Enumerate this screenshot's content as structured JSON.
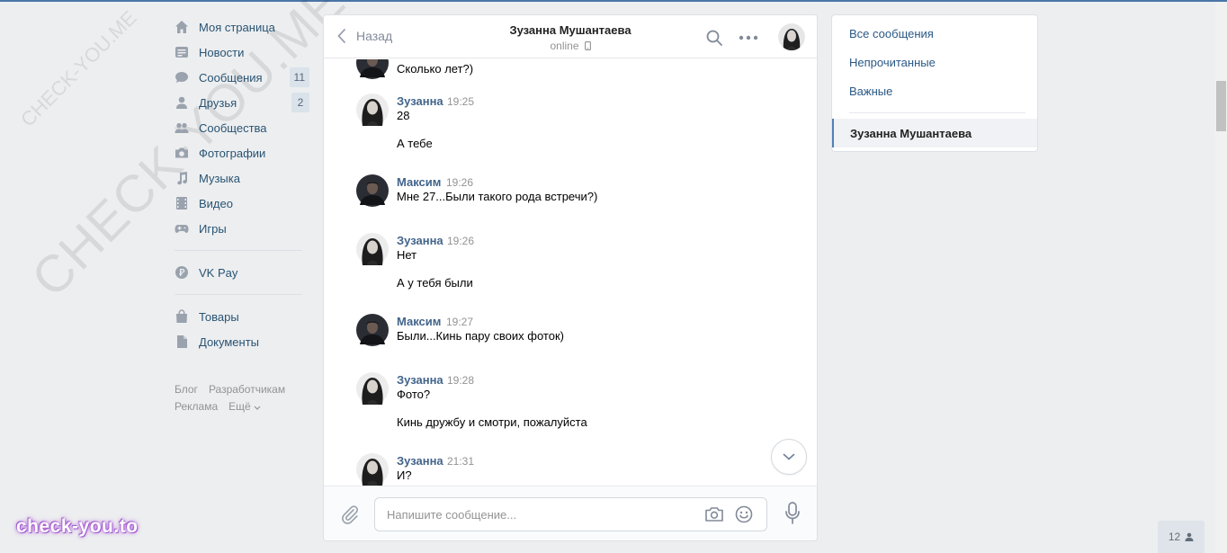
{
  "watermark": {
    "small": "CHECK-YOU.ME",
    "big": "CHECK-YOU.ME",
    "brand": "check-you.to"
  },
  "nav": {
    "items": [
      {
        "label": "Моя страница",
        "icon": "home-icon"
      },
      {
        "label": "Новости",
        "icon": "news-icon"
      },
      {
        "label": "Сообщения",
        "icon": "messages-icon",
        "count": "11"
      },
      {
        "label": "Друзья",
        "icon": "friends-icon",
        "count": "2"
      },
      {
        "label": "Сообщества",
        "icon": "communities-icon"
      },
      {
        "label": "Фотографии",
        "icon": "camera-icon"
      },
      {
        "label": "Музыка",
        "icon": "music-icon"
      },
      {
        "label": "Видео",
        "icon": "video-icon"
      },
      {
        "label": "Игры",
        "icon": "gamepad-icon"
      },
      {
        "label": "VK Pay",
        "icon": "vkpay-icon"
      },
      {
        "label": "Товары",
        "icon": "bag-icon"
      },
      {
        "label": "Документы",
        "icon": "document-icon"
      }
    ],
    "footer": {
      "blog": "Блог",
      "developers": "Разработчикам",
      "ads": "Реклама",
      "more": "Ещё"
    }
  },
  "chat": {
    "back_label": "Назад",
    "peer_name": "Зузанна Мушантаева",
    "peer_status": "online",
    "composer_placeholder": "Напишите сообщение...",
    "messages": [
      {
        "author": "",
        "time": "",
        "lines": [
          "Сколько лет?)"
        ],
        "avatar": "male"
      },
      {
        "author": "Зузанна",
        "time": "19:25",
        "lines": [
          "28",
          "А тебе"
        ],
        "avatar": "female"
      },
      {
        "author": "Максим",
        "time": "19:26",
        "lines": [
          "Мне 27...Были такого рода встречи?)"
        ],
        "avatar": "male"
      },
      {
        "author": "Зузанна",
        "time": "19:26",
        "lines": [
          "Нет",
          "А у тебя были"
        ],
        "avatar": "female"
      },
      {
        "author": "Максим",
        "time": "19:27",
        "lines": [
          "Были...Кинь пару своих фоток)"
        ],
        "avatar": "male"
      },
      {
        "author": "Зузанна",
        "time": "19:28",
        "lines": [
          "Фото?",
          "Кинь дружбу и смотри, пожалуйста"
        ],
        "avatar": "female"
      },
      {
        "author": "Зузанна",
        "time": "21:31",
        "lines": [
          "И?"
        ],
        "avatar": "female"
      }
    ]
  },
  "right_menu": {
    "all": "Все сообщения",
    "unread": "Непрочитанные",
    "important": "Важные",
    "active_dialog": "Зузанна Мушантаева"
  },
  "chat_widget": {
    "count": "12"
  },
  "colors": {
    "accent": "#4a76a8",
    "link": "#2a5885",
    "author": "#42648b",
    "muted": "#939393"
  }
}
